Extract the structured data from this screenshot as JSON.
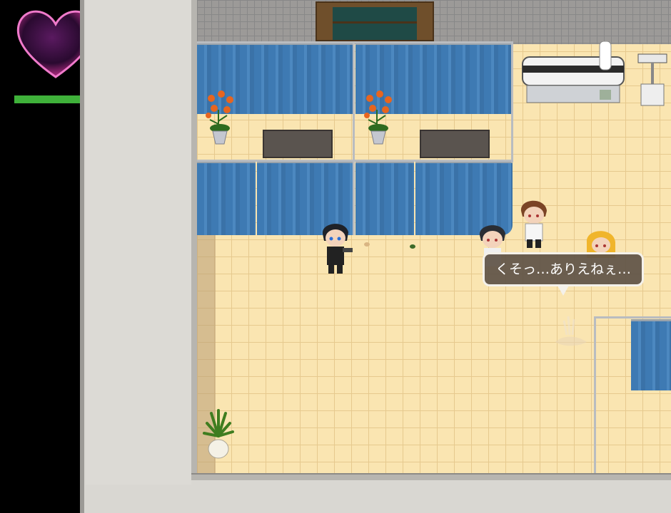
{
  "hud": {
    "heart_icon": "heart-icon",
    "hp_bar": {
      "fill": 1.0,
      "color": "#3fb13a"
    }
  },
  "dialogue": {
    "text": "くそっ…ありえねぇ…"
  },
  "colors": {
    "curtain": "#3e7ab3",
    "floor": "#fae5b1",
    "bubble_bg": "#5e5246"
  }
}
